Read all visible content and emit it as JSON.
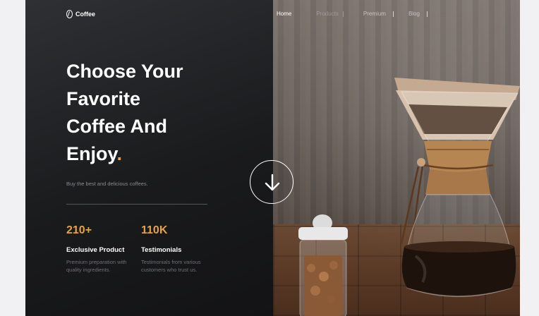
{
  "brand": {
    "name": "Coffee"
  },
  "nav": {
    "links": [
      {
        "label": "Home",
        "active": true
      },
      {
        "label": "Products",
        "active": false
      },
      {
        "label": "Premium",
        "active": false
      },
      {
        "label": "Blog",
        "active": false
      }
    ]
  },
  "hero": {
    "headline_lines": [
      "Choose Your",
      "Favorite",
      "Coffee And",
      "Enjoy"
    ],
    "headline_dot": ".",
    "subtitle": "Buy the best and delicious coffees."
  },
  "stats": [
    {
      "value": "210+",
      "title": "Exclusive Product",
      "description": "Premium preparation with quality ingredients."
    },
    {
      "value": "110K",
      "title": "Testimonials",
      "description": "Testimonials from various customers who trust us."
    }
  ],
  "colors": {
    "accent": "#e8a33b",
    "panel_dark": "#1b1b1d",
    "page_bg": "#f1f1f3"
  },
  "icons": {
    "scroll": "arrow-down-icon",
    "logo": "coffee-bean-icon"
  }
}
